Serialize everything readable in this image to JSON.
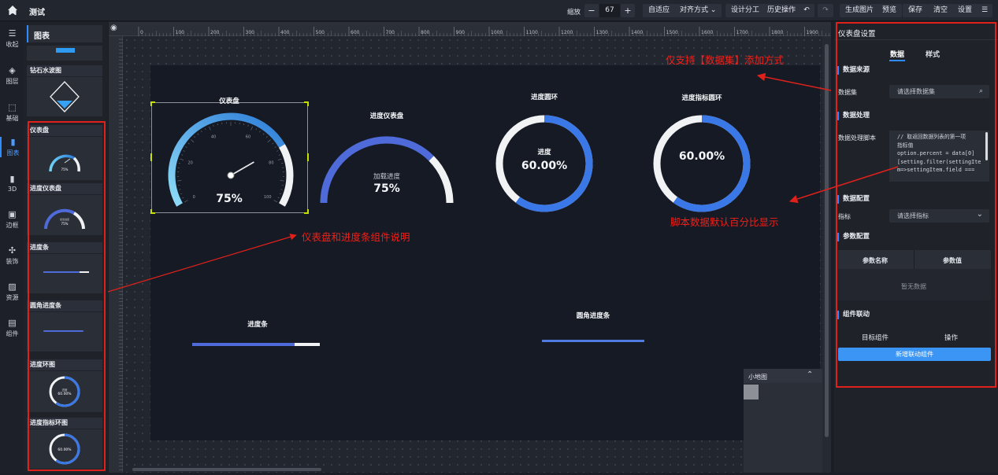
{
  "app": {
    "title": "测试"
  },
  "toolbar": {
    "zoom_label": "缩放",
    "zoom_value": "67",
    "fit": "自适应",
    "align": "对齐方式",
    "design_split": "设计分工",
    "history": "历史操作",
    "gen_image": "生成图片",
    "preview": "预览",
    "save": "保存",
    "clear": "清空",
    "settings": "设置"
  },
  "rail": [
    {
      "label": "收起",
      "icon": "collapse-icon"
    },
    {
      "label": "图层",
      "icon": "layers-icon"
    },
    {
      "label": "基础",
      "icon": "cube-icon"
    },
    {
      "label": "图表",
      "icon": "chart-icon"
    },
    {
      "label": "3D",
      "icon": "box3d-icon"
    },
    {
      "label": "边框",
      "icon": "border-icon"
    },
    {
      "label": "装饰",
      "icon": "decoration-icon"
    },
    {
      "label": "资源",
      "icon": "image-icon"
    },
    {
      "label": "组件",
      "icon": "component-icon"
    }
  ],
  "panel": {
    "title": "图表",
    "items": [
      "钻石水波图",
      "仪表盘",
      "进度仪表盘",
      "进度条",
      "圆角进度条",
      "进度环图",
      "进度指标环图"
    ],
    "thumb_text": {
      "gauge": "75%",
      "progress_gauge_sub": "加载进度",
      "progress_gauge": "75%",
      "ring_sub": "进度",
      "ring": "60.00%",
      "ring_indicator": "60.00%"
    }
  },
  "canvas": {
    "gauge": {
      "title": "仪表盘",
      "value": 75,
      "value_text": "75%",
      "ticks": [
        "0",
        "20",
        "40",
        "60",
        "80",
        "100"
      ]
    },
    "progress_gauge": {
      "title": "进度仪表盘",
      "sub": "加载进度",
      "value": 75,
      "value_text": "75%"
    },
    "ring": {
      "title": "进度圆环",
      "sub": "进度",
      "value": 60,
      "value_text": "60.00%"
    },
    "ring_indicator": {
      "title": "进度指标圆环",
      "value": 60,
      "value_text": "60.00%"
    },
    "bar": {
      "title": "进度条",
      "value": 80
    },
    "round_bar": {
      "title": "圆角进度条",
      "value": 100
    },
    "ruler_labels": [
      "0",
      "100",
      "200",
      "300",
      "400",
      "500",
      "600",
      "700",
      "800",
      "900",
      "1000",
      "1100",
      "1200",
      "1300",
      "1400",
      "1500",
      "1600",
      "1700",
      "1800",
      "1900"
    ],
    "minimap_title": "小地图"
  },
  "right": {
    "title": "仪表盘设置",
    "tabs": [
      "数据",
      "样式"
    ],
    "source_section": "数据来源",
    "dataset_label": "数据集",
    "dataset_placeholder": "请选择数据集",
    "process_section": "数据处理",
    "script_label": "数据处理脚本",
    "script_lines": [
      "// 取返回数据列表的第一项",
      "指标值",
      "option.percent = data[0]",
      "[setting.filter(settingIte",
      "m=>settingItem.field ==="
    ],
    "config_section": "数据配置",
    "metric_label": "指标",
    "metric_placeholder": "请选择指标",
    "params_section": "参数配置",
    "param_name": "参数名称",
    "param_value": "参数值",
    "empty": "暂无数据",
    "link_section": "组件联动",
    "target": "目标组件",
    "action": "操作",
    "add_link": "新增联动组件"
  },
  "annotations": {
    "dataset_note": "仅支持【数据集】添加方式",
    "components_note": "仪表盘和进度条组件说明",
    "percent_note": "脚本数据默认百分比显示"
  },
  "colors": {
    "accent": "#2f8cff",
    "annotation": "#e0211b",
    "gauge_start": "#6fd3f5",
    "gauge_end": "#2b7bd8",
    "ring_blue": "#3a78e8",
    "ring_grey": "#f1f2f4"
  }
}
